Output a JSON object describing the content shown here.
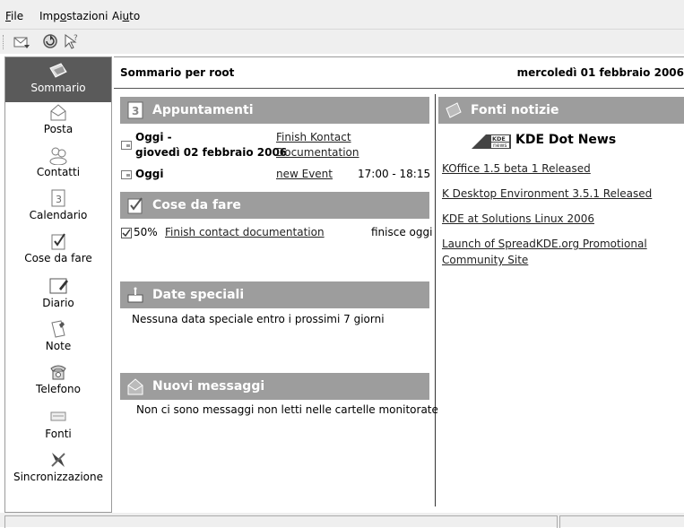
{
  "menubar": {
    "file_first": "F",
    "file_rest": "ile",
    "settings_a": "Imp",
    "settings_b": "o",
    "settings_c": "stazioni",
    "help_a": "Ai",
    "help_b": "u",
    "help_c": "to"
  },
  "toolbar": {
    "icons": [
      "mail-check-icon",
      "sync-icon",
      "whats-this-icon"
    ]
  },
  "sidebar": {
    "items": [
      {
        "label": "Sommario",
        "icon": "summary-icon"
      },
      {
        "label": "Posta",
        "icon": "mail-icon"
      },
      {
        "label": "Contatti",
        "icon": "contacts-icon"
      },
      {
        "label": "Calendario",
        "icon": "calendar-icon"
      },
      {
        "label": "Cose da fare",
        "icon": "todo-icon"
      },
      {
        "label": "Diario",
        "icon": "journal-icon"
      },
      {
        "label": "Note",
        "icon": "notes-icon"
      },
      {
        "label": "Telefono",
        "icon": "phone-icon"
      },
      {
        "label": "Fonti",
        "icon": "feeds-icon"
      },
      {
        "label": "Sincronizzazione",
        "icon": "sync-icon"
      }
    ]
  },
  "header": {
    "title": "Sommario per root",
    "date": "mercoledì 01 febbraio 2006"
  },
  "appointments": {
    "title": "Appuntamenti",
    "rows": [
      {
        "when_line1": "Oggi -",
        "when_line2": "giovedì 02 febbraio 2006",
        "title_line1": "Finish Kontact ",
        "title_line2": "Documentation",
        "time": ""
      },
      {
        "when_line1": "Oggi",
        "when_line2": "",
        "title_line1": "new Event",
        "title_line2": "",
        "time": "17:00 - 18:15"
      }
    ]
  },
  "todos": {
    "title": "Cose da fare",
    "rows": [
      {
        "percent": "50%",
        "title": "Finish contact documentation",
        "due": "finisce oggi"
      }
    ]
  },
  "special_dates": {
    "title": "Date speciali",
    "message": "Nessuna data speciale entro i prossimi 7 giorni"
  },
  "new_messages": {
    "title": "Nuovi messaggi",
    "message": "Non ci sono messaggi non letti nelle cartelle monitorate"
  },
  "news": {
    "title": "Fonti notizie",
    "logo_text_a": "KDE",
    "logo_text_b": "news",
    "source": "KDE Dot News",
    "items": [
      {
        "line1": "KOffice 1.5 beta 1 Released",
        "line2": ""
      },
      {
        "line1": "K Desktop Environment 3.5.1 Released",
        "line2": ""
      },
      {
        "line1": "KDE at Solutions Linux 2006",
        "line2": ""
      },
      {
        "line1": "Launch of SpreadKDE.org Promotional ",
        "line2": "Community Site"
      }
    ]
  },
  "colors": {
    "section_bar": "#9d9d9d",
    "active_item": "#5a5a5a"
  }
}
